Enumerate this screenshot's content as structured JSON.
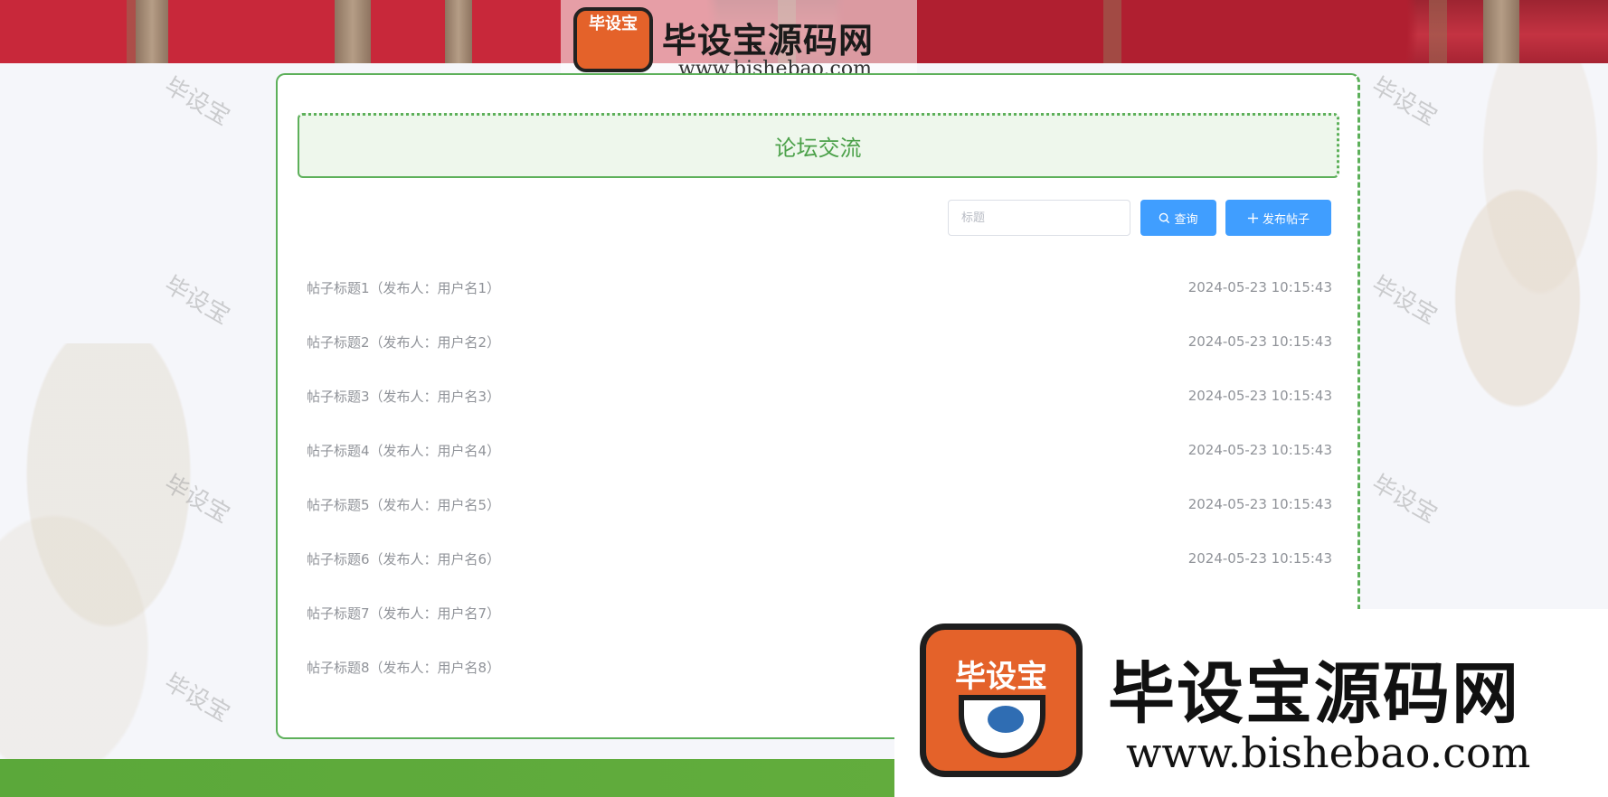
{
  "brand": {
    "name": "毕设宝源码网",
    "url": "www.bishebao.com",
    "badge": "毕设宝"
  },
  "watermark_text": "毕设宝",
  "page_title": "论坛交流",
  "search": {
    "placeholder": "标题",
    "value": "",
    "search_button": "查询",
    "post_button": "发布帖子"
  },
  "posts": [
    {
      "title": "帖子标题1（发布人：用户名1）",
      "time": "2024-05-23 10:15:43"
    },
    {
      "title": "帖子标题2（发布人：用户名2）",
      "time": "2024-05-23 10:15:43"
    },
    {
      "title": "帖子标题3（发布人：用户名3）",
      "time": "2024-05-23 10:15:43"
    },
    {
      "title": "帖子标题4（发布人：用户名4）",
      "time": "2024-05-23 10:15:43"
    },
    {
      "title": "帖子标题5（发布人：用户名5）",
      "time": "2024-05-23 10:15:43"
    },
    {
      "title": "帖子标题6（发布人：用户名6）",
      "time": "2024-05-23 10:15:43"
    },
    {
      "title": "帖子标题7（发布人：用户名7）",
      "time": ""
    },
    {
      "title": "帖子标题8（发布人：用户名8）",
      "time": ""
    }
  ],
  "colors": {
    "accent": "#409eff",
    "theme_green": "#5db05a",
    "title_text": "#4ca14a",
    "footer": "#5ba83a"
  }
}
